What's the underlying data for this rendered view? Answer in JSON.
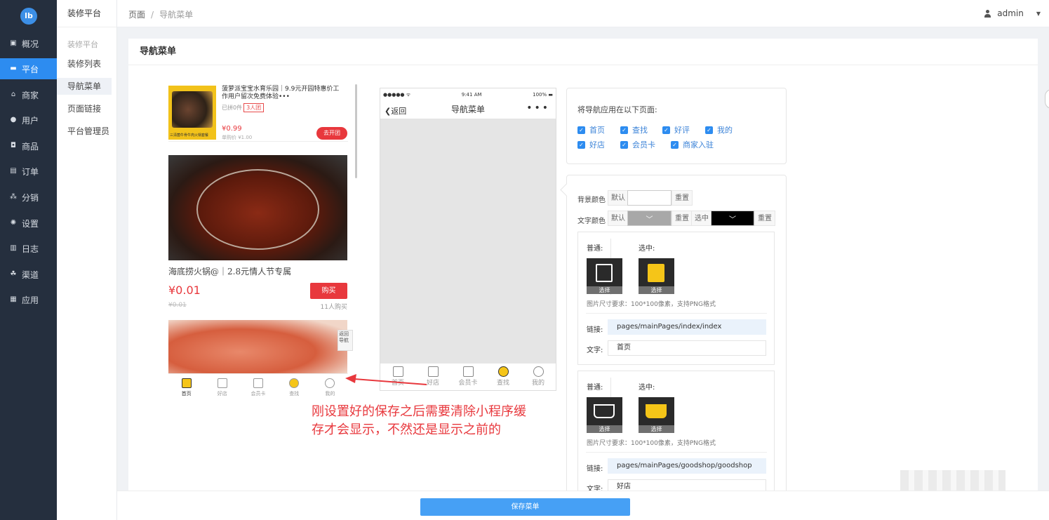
{
  "rail": {
    "logo": "lb",
    "items": [
      {
        "label": "概况",
        "icon": "dashboard-icon"
      },
      {
        "label": "平台",
        "icon": "monitor-icon"
      },
      {
        "label": "商家",
        "icon": "store-icon"
      },
      {
        "label": "用户",
        "icon": "user-icon"
      },
      {
        "label": "商品",
        "icon": "goods-icon"
      },
      {
        "label": "订单",
        "icon": "order-icon"
      },
      {
        "label": "分销",
        "icon": "sitemap-icon"
      },
      {
        "label": "设置",
        "icon": "gear-icon"
      },
      {
        "label": "日志",
        "icon": "log-icon"
      },
      {
        "label": "渠道",
        "icon": "channel-icon"
      },
      {
        "label": "应用",
        "icon": "apps-icon"
      }
    ],
    "active_index": 1,
    "accent": "#2d8cf0"
  },
  "sub": {
    "header": "装修平台",
    "group": "装修平台",
    "links": [
      "装修列表",
      "导航菜单",
      "页面链接",
      "平台管理员"
    ],
    "active_index": 1
  },
  "topbar": {
    "crumb_root": "页面",
    "crumb_sep": "/",
    "crumb_current": "导航菜单",
    "user": "admin"
  },
  "card": {
    "title": "导航菜单"
  },
  "preview": {
    "p1_title": "菠萝派宝宝水育乐园｜9.9元开园特惠价工作用户留次免费体验•••",
    "p1_group": "已拼0件",
    "p1_tag": "3人团",
    "p1_price": "¥0.99",
    "p1_orig": "单购价 ¥1.00",
    "p1_btn": "去开团",
    "p1_thumb_caption": "三清菌牛骨牛肉火锅套餐",
    "p2_name": "海底捞火锅@｜2.8元情人节专属",
    "p2_price": "¥0.01",
    "p2_buy": "购买",
    "p2_orig": "¥0.01",
    "p2_sold": "11人购买",
    "p3_back": "返回导航",
    "tabs": [
      "首页",
      "好店",
      "会员卡",
      "查找",
      "我的"
    ]
  },
  "phone": {
    "signal": "●●●●● ᯤ",
    "time": "9:41 AM",
    "battery": "100% ▬",
    "back": "返回",
    "title": "导航菜单",
    "more": "•••",
    "tabs": [
      "首页",
      "好店",
      "会员卡",
      "查找",
      "我的"
    ]
  },
  "apply": {
    "label": "将导航应用在以下页面:",
    "pages": [
      "首页",
      "查找",
      "好评",
      "我的",
      "好店",
      "会员卡",
      "商家入驻"
    ]
  },
  "settings": {
    "bg_label": "背景颜色",
    "text_label": "文字颜色",
    "default": "默认",
    "reset": "重置",
    "selected": "选中",
    "text_default_color": "#a8a8a8",
    "text_selected_color": "#000000",
    "tab_cards": [
      {
        "normal_label": "普通:",
        "selected_label": "选中:",
        "choose": "选择",
        "hint": "图片尺寸要求：100*100像素，支持PNG格式",
        "link_label": "链接:",
        "link_value": "pages/mainPages/index/index",
        "text_label": "文字:",
        "text_value": "首页"
      },
      {
        "normal_label": "普通:",
        "selected_label": "选中:",
        "choose": "选择",
        "hint": "图片尺寸要求：100*100像素，支持PNG格式",
        "link_label": "链接:",
        "link_value": "pages/mainPages/goodshop/goodshop",
        "text_label": "文字:",
        "text_value": "好店"
      }
    ]
  },
  "annotation": {
    "line1": "刚设置好的保存之后需要清除小程序缓",
    "line2": "存才会显示，不然还是显示之前的",
    "color": "#e8383d"
  },
  "save": {
    "label": "保存菜单",
    "color": "#46a0f5"
  }
}
